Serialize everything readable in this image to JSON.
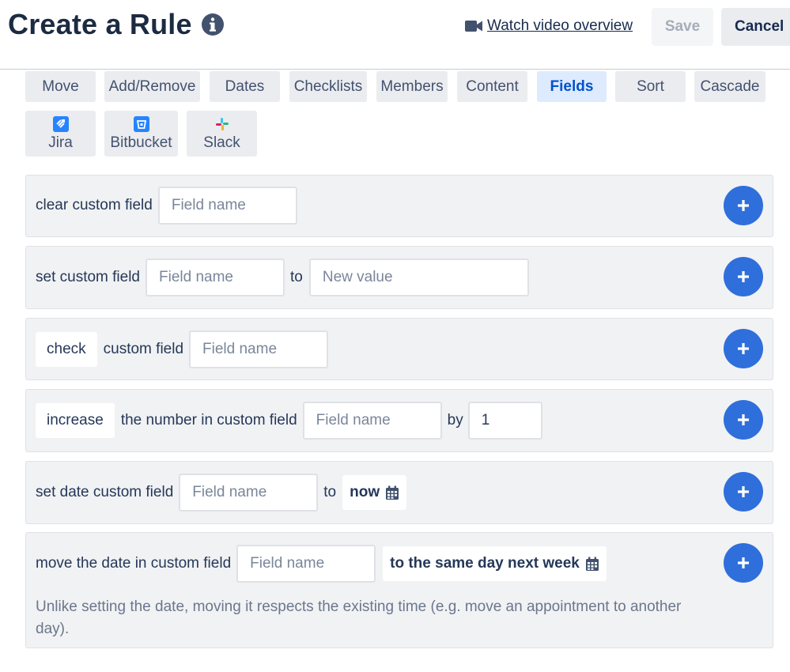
{
  "header": {
    "title": "Create a Rule",
    "watch_label": "Watch video overview",
    "save_label": "Save",
    "cancel_label": "Cancel"
  },
  "tabs": [
    "Move",
    "Add/Remove",
    "Dates",
    "Checklists",
    "Members",
    "Content",
    "Fields",
    "Sort",
    "Cascade"
  ],
  "active_tab": "Fields",
  "integrations": [
    "Jira",
    "Bitbucket",
    "Slack"
  ],
  "rules": {
    "clear": {
      "label": "clear custom field",
      "field_placeholder": "Field name"
    },
    "set": {
      "label": "set custom field",
      "field_placeholder": "Field name",
      "to": "to",
      "value_placeholder": "New value"
    },
    "check": {
      "chip": "check",
      "label": "custom field",
      "field_placeholder": "Field name"
    },
    "increase": {
      "chip": "increase",
      "label": "the number in custom field",
      "field_placeholder": "Field name",
      "by": "by",
      "value": "1"
    },
    "set_date": {
      "label": "set date custom field",
      "field_placeholder": "Field name",
      "to": "to",
      "date_value": "now"
    },
    "move_date": {
      "label": "move the date in custom field",
      "field_placeholder": "Field name",
      "date_value": "to the same day next week",
      "note": "Unlike setting the date, moving it respects the existing time (e.g. move an appointment to another day)."
    }
  },
  "colors": {
    "accent": "#2f6fdc",
    "active_tab_bg": "#deebff",
    "active_tab_text": "#0052cc",
    "row_bg": "#f1f2f4"
  }
}
